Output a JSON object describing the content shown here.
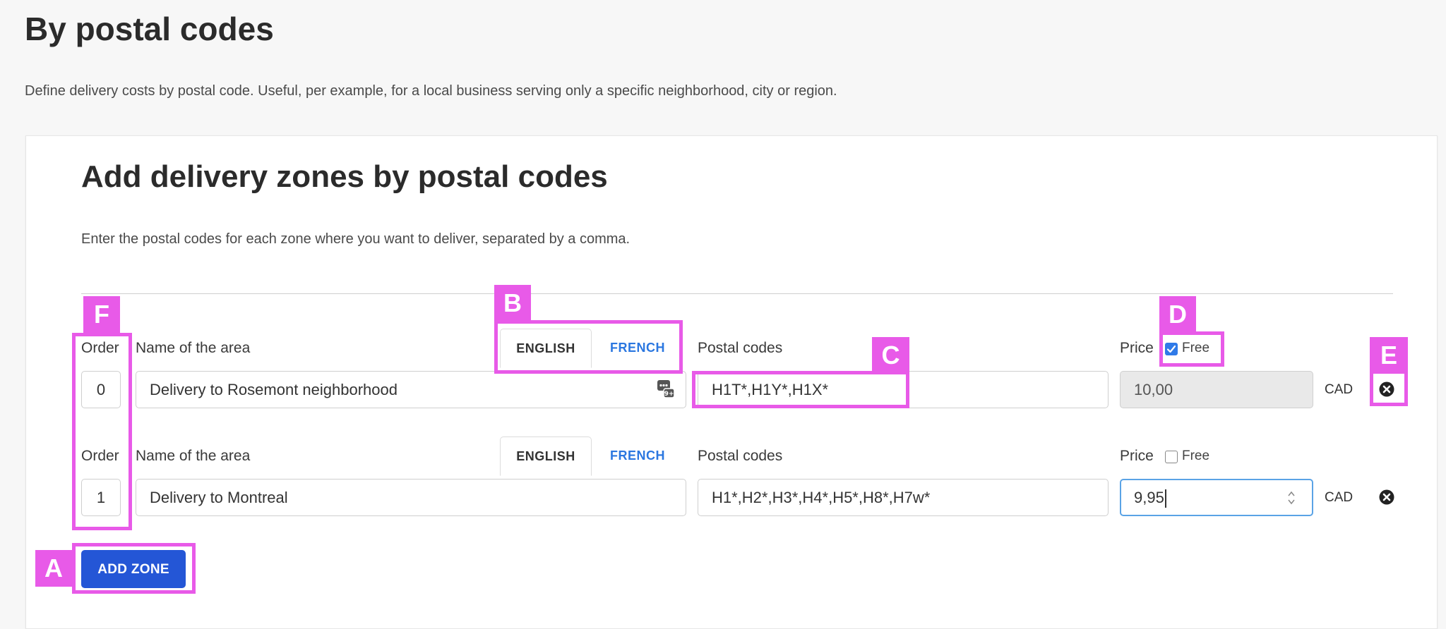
{
  "page": {
    "title": "By postal codes",
    "description": "Define delivery costs by postal code. Useful, per example, for a local business serving only a specific neighborhood, city or region."
  },
  "card": {
    "title": "Add delivery zones by postal codes",
    "description": "Enter the postal codes for each zone where you want to deliver, separated by a comma."
  },
  "zones": [
    {
      "order_label": "Order",
      "order_value": "0",
      "name_label": "Name of the area",
      "tabs": [
        "ENGLISH",
        "FRENCH"
      ],
      "name_value": "Delivery to Rosemont neighborhood",
      "postal_label": "Postal codes",
      "postal_value": "H1T*,H1Y*,H1X*",
      "price_label": "Price",
      "free_label": "Free",
      "free_checked": true,
      "price_value": "10,00",
      "currency": "CAD"
    },
    {
      "order_label": "Order",
      "order_value": "1",
      "name_label": "Name of the area",
      "tabs": [
        "ENGLISH",
        "FRENCH"
      ],
      "name_value": "Delivery to Montreal",
      "postal_label": "Postal codes",
      "postal_value": "H1*,H2*,H3*,H4*,H5*,H8*,H7w*",
      "price_label": "Price",
      "free_label": "Free",
      "free_checked": false,
      "price_value": "9,95",
      "currency": "CAD"
    }
  ],
  "actions": {
    "add_zone_label": "ADD ZONE"
  },
  "annotations": [
    "A",
    "B",
    "C",
    "D",
    "E",
    "F"
  ],
  "colors": {
    "primary": "#2456d6",
    "link": "#2b77e0",
    "highlight": "#e85ae8",
    "checkbox": "#2f7ae8"
  },
  "icons": [
    "translate-icon",
    "remove-icon",
    "checkmark-icon",
    "spinner-arrows-icon"
  ]
}
